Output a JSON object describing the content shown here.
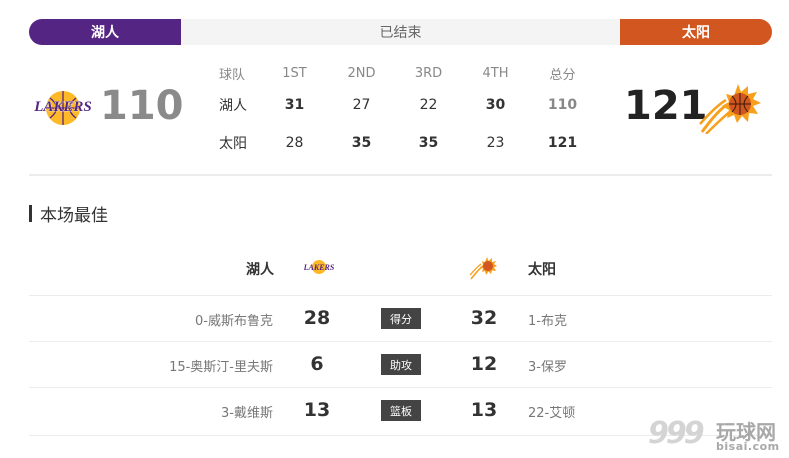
{
  "status": {
    "home_team": "湖人",
    "state": "已结束",
    "away_team": "太阳"
  },
  "colors": {
    "home_primary": "#552583",
    "home_secondary": "#fdb927",
    "away_primary": "#d1561f",
    "away_secondary": "#f7a01d"
  },
  "scoreboard": {
    "home_score": "110",
    "away_score": "121",
    "home_logo_text": "LAKERS",
    "headers": [
      "球队",
      "1ST",
      "2ND",
      "3RD",
      "4TH",
      "总分"
    ],
    "rows": [
      {
        "team": "湖人",
        "q1": "31",
        "q2": "27",
        "q3": "22",
        "q4": "30",
        "total": "110"
      },
      {
        "team": "太阳",
        "q1": "28",
        "q2": "35",
        "q3": "35",
        "q4": "23",
        "total": "121"
      }
    ]
  },
  "best": {
    "title": "本场最佳",
    "home_team": "湖人",
    "away_team": "太阳",
    "rows": [
      {
        "home_player": "0-威斯布鲁克",
        "home_value": "28",
        "stat": "得分",
        "away_value": "32",
        "away_player": "1-布克"
      },
      {
        "home_player": "15-奥斯汀-里夫斯",
        "home_value": "6",
        "stat": "助攻",
        "away_value": "12",
        "away_player": "3-保罗"
      },
      {
        "home_player": "3-戴维斯",
        "home_value": "13",
        "stat": "篮板",
        "away_value": "13",
        "away_player": "22-艾顿"
      }
    ]
  },
  "watermark": {
    "digits": "999",
    "brand": "玩球网",
    "url": "bisai.com"
  }
}
